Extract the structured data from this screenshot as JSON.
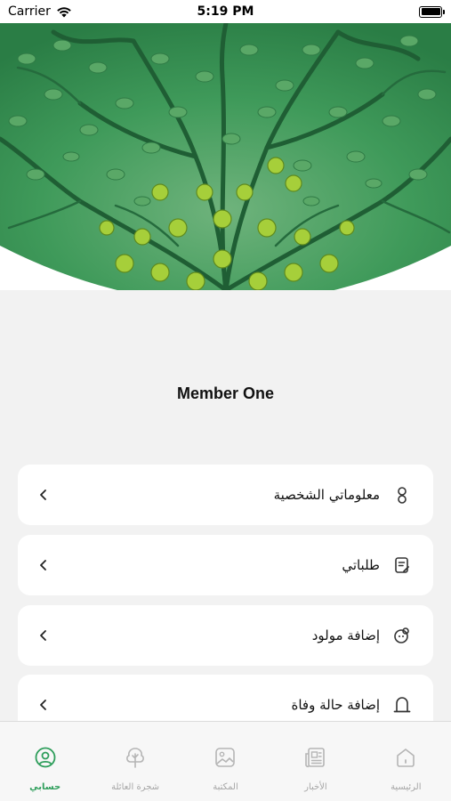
{
  "status_bar": {
    "carrier": "Carrier",
    "time": "5:19 PM"
  },
  "profile": {
    "name": "Member One"
  },
  "menu": {
    "items": [
      {
        "label": "معلوماتي الشخصية",
        "icon": "user-icon"
      },
      {
        "label": "طلباتي",
        "icon": "document-edit-icon"
      },
      {
        "label": "إضافة مولود",
        "icon": "baby-icon"
      },
      {
        "label": "إضافة حالة وفاة",
        "icon": "tombstone-icon"
      }
    ]
  },
  "tabs": [
    {
      "label": "الرئيسية",
      "icon": "home-icon"
    },
    {
      "label": "الأخبار",
      "icon": "newspaper-icon"
    },
    {
      "label": "المكتبة",
      "icon": "gallery-icon"
    },
    {
      "label": "شجرة العائلة",
      "icon": "tree-icon"
    },
    {
      "label": "حسابي",
      "icon": "account-icon",
      "active": true
    }
  ],
  "colors": {
    "accent": "#2e9e5b",
    "header_green": "#3f9a5a"
  }
}
